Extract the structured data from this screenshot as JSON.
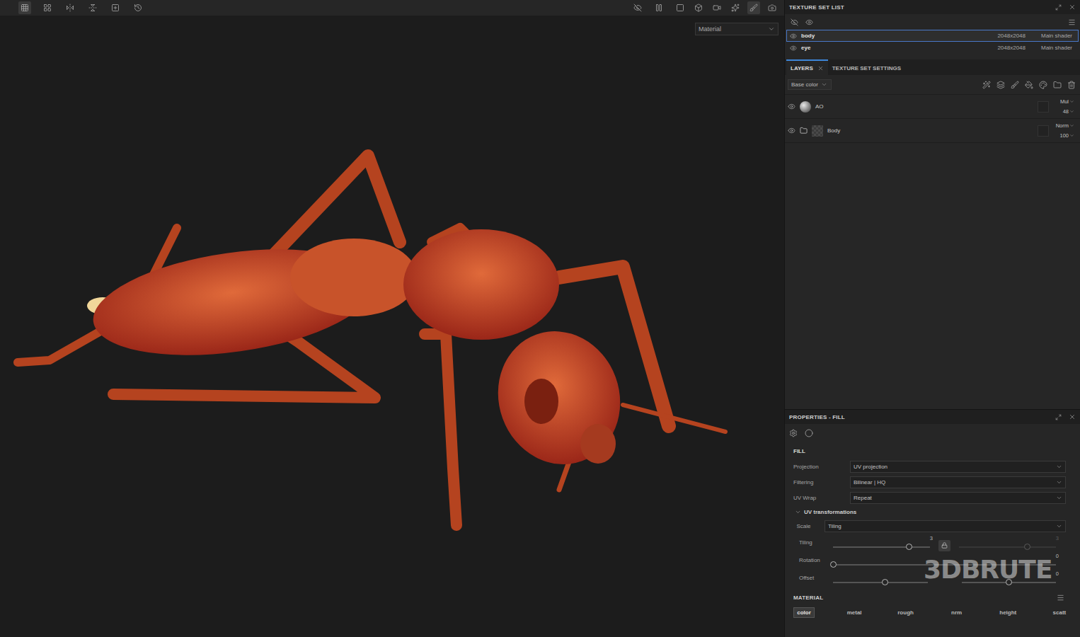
{
  "viewport": {
    "mode_dropdown": "Material"
  },
  "texture_set_list": {
    "title": "TEXTURE SET LIST",
    "items": [
      {
        "name": "body",
        "resolution": "2048x2048",
        "shader": "Main shader",
        "selected": true,
        "visible": true
      },
      {
        "name": "eye",
        "resolution": "2048x2048",
        "shader": "Main shader",
        "selected": false,
        "visible": true
      }
    ]
  },
  "layer_tabs": [
    {
      "label": "LAYERS",
      "selected": true
    },
    {
      "label": "TEXTURE SET SETTINGS",
      "selected": false
    }
  ],
  "channel_dropdown": "Base color",
  "layers": [
    {
      "name": "AO",
      "kind": "fill",
      "visible": true,
      "blend": "Mul",
      "opacity": "48"
    },
    {
      "name": "Body",
      "kind": "folder",
      "visible": true,
      "blend": "Norm",
      "opacity": "100"
    }
  ],
  "properties": {
    "title": "PROPERTIES - FILL",
    "section": "FILL",
    "fields": [
      {
        "label": "Projection",
        "value": "UV projection"
      },
      {
        "label": "Filtering",
        "value": "Bilinear | HQ"
      },
      {
        "label": "UV Wrap",
        "value": "Repeat"
      }
    ],
    "uv_transformations": {
      "label": "UV transformations",
      "expanded": true,
      "scale": {
        "label": "Scale",
        "value": "Tiling"
      },
      "sliders": [
        {
          "label": "Tiling",
          "locked": true,
          "tracks": [
            {
              "level": 0.78,
              "reading": "3",
              "disabled": false
            },
            {
              "level": 0.7,
              "reading": "3",
              "disabled": true
            }
          ]
        },
        {
          "label": "Rotation",
          "tracks": [
            {
              "level": 0,
              "reading": "0",
              "disabled": false
            }
          ]
        },
        {
          "label": "Offset",
          "tracks": [
            {
              "level": 0.55,
              "disabled": false
            },
            {
              "level": 0.5,
              "reading": "0",
              "disabled": false
            }
          ]
        }
      ]
    }
  },
  "material": {
    "title": "MATERIAL",
    "channels": [
      {
        "label": "color",
        "selected": true
      },
      {
        "label": "metal",
        "selected": false
      },
      {
        "label": "rough",
        "selected": false
      },
      {
        "label": "nrm",
        "selected": false
      },
      {
        "label": "height",
        "selected": false
      },
      {
        "label": "scatt",
        "selected": false
      }
    ]
  },
  "watermark": "3DBRUTE"
}
